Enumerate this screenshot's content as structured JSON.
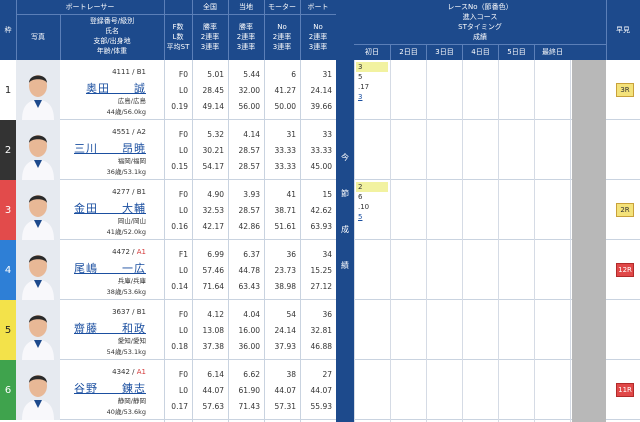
{
  "header": {
    "frame": "枠",
    "photo": "写真",
    "racer_group": "ボートレーサー",
    "racer_sub": [
      "登録番号/級別",
      "氏名",
      "支部/出身地",
      "年齢/体重"
    ],
    "fstats": [
      "F数",
      "L数",
      "平均ST"
    ],
    "national": "全国",
    "local": "当地",
    "motor": "モーター",
    "boat": "ボート",
    "rate_labels": [
      "勝率",
      "2連率",
      "3連率"
    ],
    "num_labels": [
      "No",
      "2連率",
      "3連率"
    ],
    "race_title": [
      "レースNo（節番色）",
      "進入コース",
      "STタイミング",
      "成績"
    ],
    "days": [
      "初日",
      "2日目",
      "3日目",
      "4日目",
      "5日目",
      "最終日"
    ],
    "early": "早見"
  },
  "konsetsu": [
    "今",
    "節",
    "成",
    "績"
  ],
  "racers": [
    {
      "frame": "1",
      "frame_bg": "#ffffff",
      "frame_fg": "#222222",
      "reg": "4111",
      "grade": "B1",
      "grade_color": "#333333",
      "name": "奥田　　誠",
      "branch": "広島/広島",
      "age": "44歳/56.0kg",
      "f": "F0",
      "l": "L0",
      "st": "0.19",
      "nat": [
        "5.01",
        "28.45",
        "49.14"
      ],
      "loc": [
        "5.44",
        "32.00",
        "56.00"
      ],
      "motor": [
        "6",
        "41.27",
        "50.00"
      ],
      "boat": [
        "31",
        "24.14",
        "39.66"
      ],
      "race": {
        "no": "3",
        "course": "5",
        "st": ".17",
        "result": "3"
      },
      "badge": "3R",
      "badge_red": false
    },
    {
      "frame": "2",
      "frame_bg": "#333333",
      "frame_fg": "#ffffff",
      "reg": "4551",
      "grade": "A2",
      "grade_color": "#333333",
      "name": "三川　　昂暁",
      "branch": "福岡/福岡",
      "age": "36歳/53.1kg",
      "f": "F0",
      "l": "L0",
      "st": "0.15",
      "nat": [
        "5.32",
        "30.21",
        "54.17"
      ],
      "loc": [
        "4.14",
        "28.57",
        "28.57"
      ],
      "motor": [
        "31",
        "33.33",
        "33.33"
      ],
      "boat": [
        "33",
        "33.33",
        "45.00"
      ],
      "race": null,
      "badge": "",
      "badge_red": false
    },
    {
      "frame": "3",
      "frame_bg": "#e24b4b",
      "frame_fg": "#ffffff",
      "reg": "4277",
      "grade": "B1",
      "grade_color": "#333333",
      "name": "金田　　大輔",
      "branch": "岡山/岡山",
      "age": "41歳/52.0kg",
      "f": "F0",
      "l": "L0",
      "st": "0.16",
      "nat": [
        "4.90",
        "32.53",
        "42.17"
      ],
      "loc": [
        "3.93",
        "28.57",
        "42.86"
      ],
      "motor": [
        "41",
        "38.71",
        "51.61"
      ],
      "boat": [
        "15",
        "42.62",
        "63.93"
      ],
      "race": {
        "no": "2",
        "course": "6",
        "st": ".10",
        "result": "5"
      },
      "badge": "2R",
      "badge_red": false
    },
    {
      "frame": "4",
      "frame_bg": "#2e7fd6",
      "frame_fg": "#ffffff",
      "reg": "4472",
      "grade": "A1",
      "grade_color": "#d43a3a",
      "name": "尾嶋　　一広",
      "branch": "兵庫/兵庫",
      "age": "38歳/53.6kg",
      "f": "F1",
      "l": "L0",
      "st": "0.14",
      "nat": [
        "6.99",
        "57.46",
        "71.64"
      ],
      "loc": [
        "6.37",
        "44.78",
        "63.43"
      ],
      "motor": [
        "36",
        "23.73",
        "38.98"
      ],
      "boat": [
        "34",
        "15.25",
        "27.12"
      ],
      "race": null,
      "badge": "12R",
      "badge_red": true
    },
    {
      "frame": "5",
      "frame_bg": "#f3e24a",
      "frame_fg": "#222222",
      "reg": "3637",
      "grade": "B1",
      "grade_color": "#333333",
      "name": "齋藤　　和政",
      "branch": "愛知/愛知",
      "age": "54歳/53.1kg",
      "f": "F0",
      "l": "L0",
      "st": "0.18",
      "nat": [
        "4.12",
        "13.08",
        "37.38"
      ],
      "loc": [
        "4.04",
        "16.00",
        "36.00"
      ],
      "motor": [
        "54",
        "24.14",
        "37.93"
      ],
      "boat": [
        "36",
        "32.81",
        "46.88"
      ],
      "race": null,
      "badge": "",
      "badge_red": false
    },
    {
      "frame": "6",
      "frame_bg": "#3fa34d",
      "frame_fg": "#ffffff",
      "reg": "4342",
      "grade": "A1",
      "grade_color": "#d43a3a",
      "name": "谷野　　錬志",
      "branch": "静岡/静岡",
      "age": "40歳/53.6kg",
      "f": "F0",
      "l": "L0",
      "st": "0.17",
      "nat": [
        "6.14",
        "44.07",
        "57.63"
      ],
      "loc": [
        "6.62",
        "61.90",
        "71.43"
      ],
      "motor": [
        "38",
        "44.07",
        "57.31"
      ],
      "boat": [
        "27",
        "44.07",
        "55.93"
      ],
      "race": null,
      "badge": "11R",
      "badge_red": true
    }
  ]
}
